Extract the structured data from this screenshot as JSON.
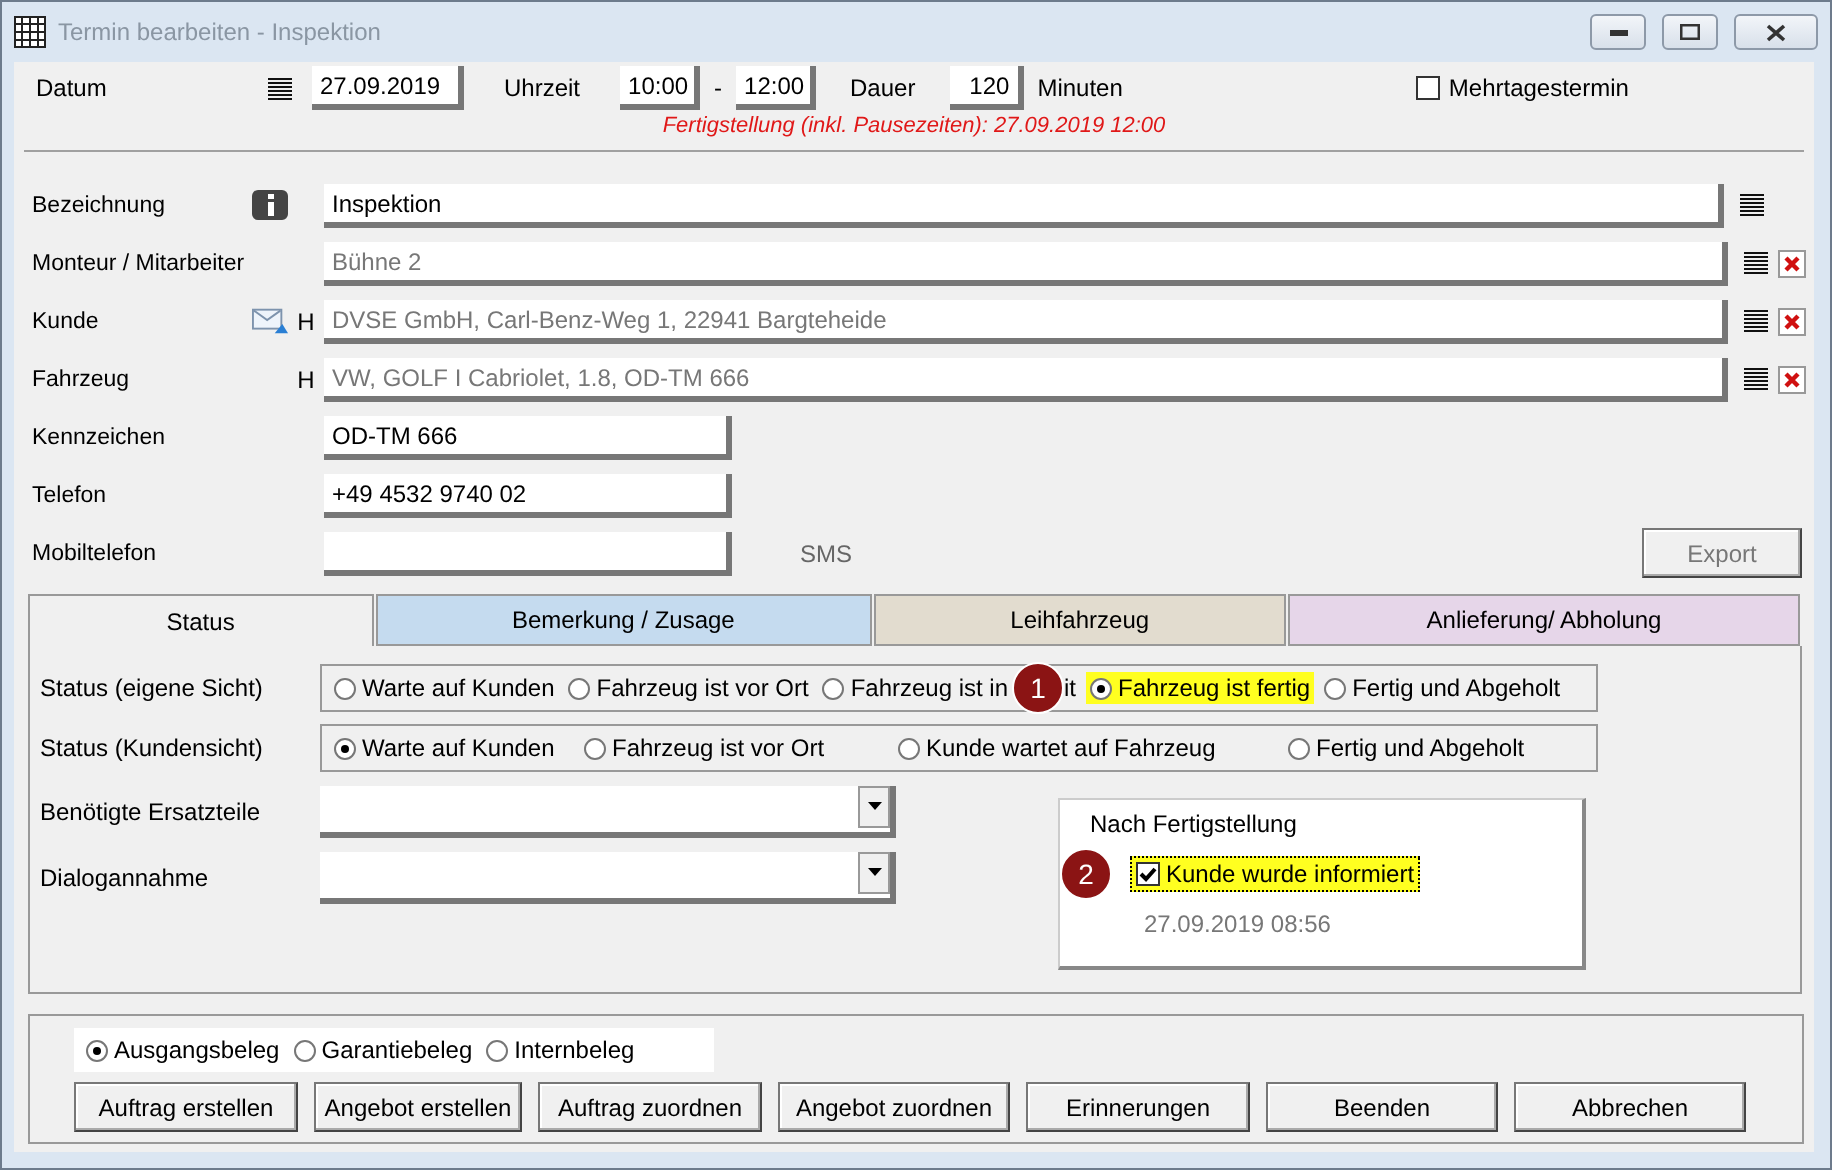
{
  "window": {
    "title": "Termin bearbeiten - Inspektion"
  },
  "schedule": {
    "date_label": "Datum",
    "date": "27.09.2019",
    "time_label": "Uhrzeit",
    "start": "10:00",
    "separator": "-",
    "end": "12:00",
    "duration_label": "Dauer",
    "duration": "120",
    "unit": "Minuten",
    "multi_day": {
      "label": "Mehrtagestermin",
      "checked": false
    },
    "completion_note": "Fertigstellung (inkl. Pausezeiten): 27.09.2019 12:00"
  },
  "fields": [
    {
      "label": "Bezeichnung",
      "kind": "info",
      "value": "Inspektion",
      "list": true,
      "removable": false,
      "wide": true,
      "greyed": false
    },
    {
      "label": "Monteur / Mitarbeiter",
      "kind": "plain",
      "value": "Bühne 2",
      "list": true,
      "removable": true,
      "wide": true,
      "greyed": true
    },
    {
      "label": "Kunde",
      "kind": "mail",
      "flag": "H",
      "value": "DVSE GmbH, Carl-Benz-Weg 1, 22941 Bargteheide",
      "list": true,
      "removable": true,
      "wide": true,
      "greyed": true
    },
    {
      "label": "Fahrzeug",
      "kind": "flag",
      "flag": "H",
      "value": "VW, GOLF I Cabriolet, 1.8, OD-TM 666",
      "list": true,
      "removable": true,
      "wide": true,
      "greyed": true
    },
    {
      "label": "Kennzeichen",
      "kind": "plain",
      "value": "OD-TM 666",
      "list": false,
      "removable": false,
      "wide": false,
      "greyed": false
    },
    {
      "label": "Telefon",
      "kind": "plain",
      "value": "+49 4532 9740 02",
      "list": false,
      "removable": false,
      "wide": false,
      "greyed": false
    },
    {
      "label": "Mobiltelefon",
      "kind": "plain",
      "list": false,
      "removable": false,
      "wide": false,
      "sms": "SMS",
      "export": "Export"
    }
  ],
  "tabs": [
    {
      "label": "Status",
      "selected": true,
      "color": "#f0f0f0"
    },
    {
      "label": "Bemerkung / Zusage",
      "selected": false,
      "color": "#c5dbef"
    },
    {
      "label": "Leihfahrzeug",
      "selected": false,
      "color": "#e2dccf"
    },
    {
      "label": "Anlieferung/ Abholung",
      "selected": false,
      "color": "#e6d6e9"
    }
  ],
  "status_groups": [
    {
      "label": "Status (eigene Sicht)",
      "options": [
        {
          "label": "Warte auf Kunden",
          "selected": false,
          "highlighted": false
        },
        {
          "label": "Fahrzeug ist vor Ort",
          "selected": false,
          "highlighted": false
        },
        {
          "label": "Fahrzeug ist in",
          "selected": false,
          "highlighted": false,
          "marker": "1",
          "label_end": "it"
        },
        {
          "label": "Fahrzeug ist fertig",
          "selected": true,
          "highlighted": true
        },
        {
          "label": "Fertig und Abgeholt",
          "selected": false,
          "highlighted": false
        }
      ]
    },
    {
      "label": "Status (Kundensicht)",
      "options": [
        {
          "label": "Warte auf Kunden",
          "selected": true,
          "highlighted": false
        },
        {
          "label": "Fahrzeug ist vor Ort",
          "selected": false,
          "highlighted": false
        },
        {
          "label": "Kunde wartet auf Fahrzeug",
          "selected": false,
          "highlighted": false
        },
        {
          "label": "Fertig und Abgeholt",
          "selected": false,
          "highlighted": false
        }
      ]
    }
  ],
  "dropdowns": [
    {
      "label": "Benötigte Ersatzteile"
    },
    {
      "label": "Dialogannahme"
    }
  ],
  "completion": {
    "title": "Nach Fertigstellung",
    "marker": "2",
    "checkbox": {
      "label": "Kunde wurde informiert",
      "checked": true,
      "highlighted": true
    },
    "timestamp": "27.09.2019 08:56"
  },
  "document_types": [
    {
      "label": "Ausgangsbeleg",
      "selected": true
    },
    {
      "label": "Garantiebeleg",
      "selected": false
    },
    {
      "label": "Internbeleg",
      "selected": false
    }
  ],
  "buttons": [
    "Auftrag erstellen",
    "Angebot erstellen",
    "Auftrag zuordnen",
    "Angebot zuordnen",
    "Erinnerungen",
    "Beenden",
    "Abbrechen"
  ]
}
